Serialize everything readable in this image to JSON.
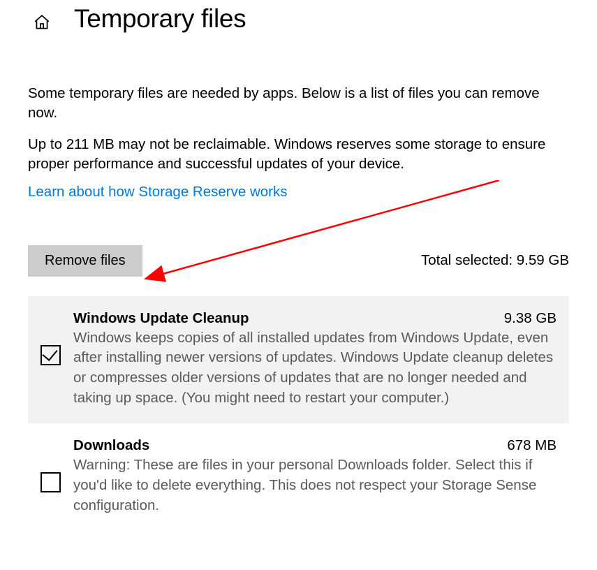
{
  "header": {
    "title": "Temporary files"
  },
  "desc": {
    "line1": "Some temporary files are needed by apps. Below is a list of files you can remove now.",
    "line2": "Up to 211 MB may not be reclaimable. Windows reserves some storage to ensure proper performance and successful updates of your device."
  },
  "link": {
    "label": "Learn about how Storage Reserve works"
  },
  "actions": {
    "remove_label": "Remove files",
    "total_label": "Total selected: 9.59 GB"
  },
  "items": [
    {
      "title": "Windows Update Cleanup",
      "size": "9.38 GB",
      "desc": "Windows keeps copies of all installed updates from Windows Update, even after installing newer versions of updates. Windows Update cleanup deletes or compresses older versions of updates that are no longer needed and taking up space. (You might need to restart your computer.)"
    },
    {
      "title": "Downloads",
      "size": "678 MB",
      "desc": "Warning: These are files in your personal Downloads folder. Select this if you'd like to delete everything. This does not respect your Storage Sense configuration."
    }
  ]
}
